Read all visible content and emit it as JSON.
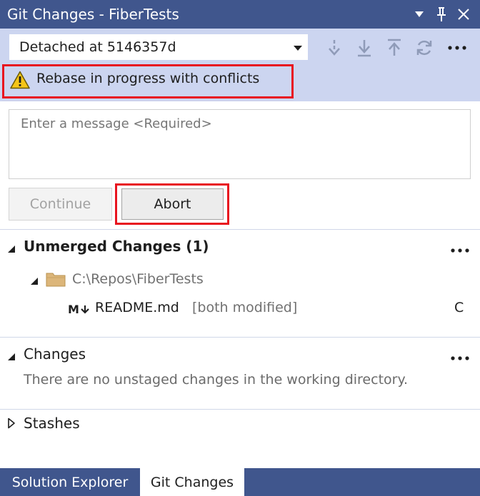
{
  "window": {
    "title": "Git Changes - FiberTests",
    "icons": [
      "window-position-dropdown-icon",
      "pin-icon",
      "close-icon"
    ]
  },
  "toolbar": {
    "branch": "Detached at 5146357d",
    "icons": [
      "fetch-icon",
      "pull-icon",
      "push-icon",
      "sync-icon",
      "more-options-icon"
    ]
  },
  "banner": {
    "text": "Rebase in progress with conflicts",
    "icon": "warning-icon"
  },
  "commit": {
    "placeholder": "Enter a message <Required>",
    "continue_label": "Continue",
    "abort_label": "Abort"
  },
  "unmerged": {
    "title": "Unmerged Changes (1)",
    "folder": "C:\\Repos\\FiberTests",
    "files": [
      {
        "icon": "M+",
        "name": "README.md",
        "detail": "[both modified]",
        "status": "C"
      }
    ]
  },
  "changes": {
    "title": "Changes",
    "empty_text": "There are no unstaged changes in the working directory."
  },
  "stashes": {
    "title": "Stashes"
  },
  "tabs": {
    "solution_explorer": "Solution Explorer",
    "git_changes": "Git Changes",
    "active": "Git Changes"
  },
  "colors": {
    "titlebar": "#40568d",
    "toolbar": "#ccd5f0",
    "highlight": "#e8141f",
    "warning": "#f5c518"
  }
}
